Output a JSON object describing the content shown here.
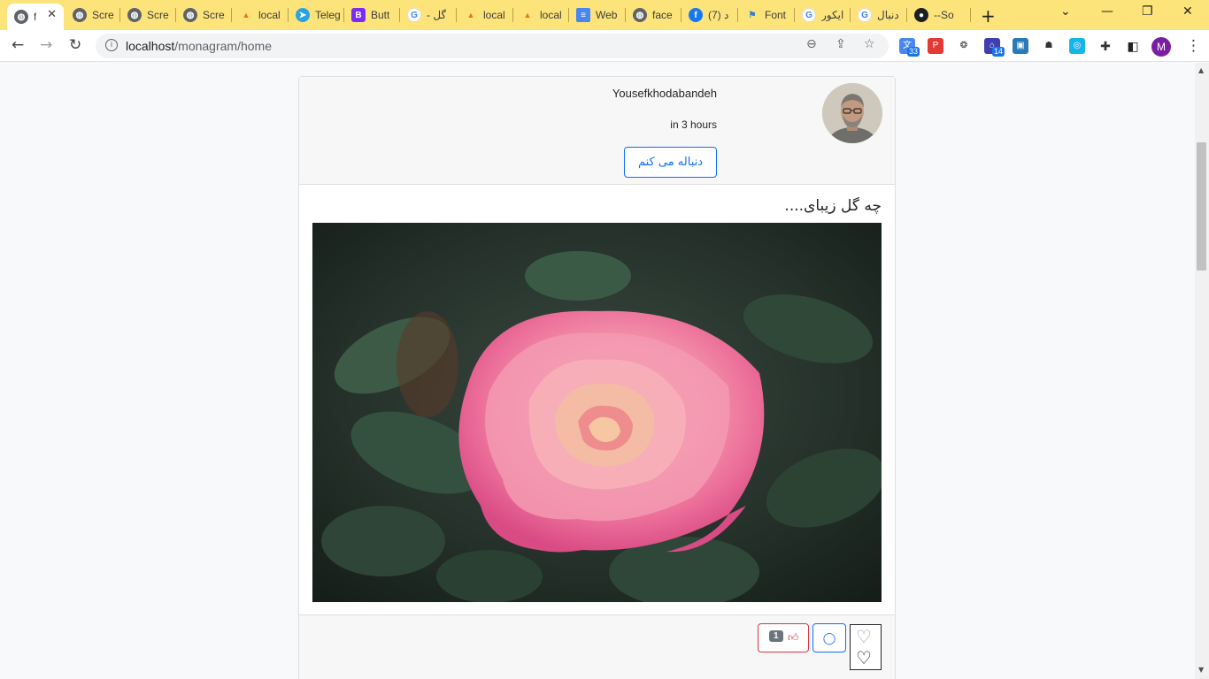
{
  "browser": {
    "tabs": [
      {
        "title": "f",
        "icon": "globe-icon",
        "active": true
      },
      {
        "title": "Scre",
        "icon": "globe-icon"
      },
      {
        "title": "Scre",
        "icon": "globe-icon"
      },
      {
        "title": "Scre",
        "icon": "globe-icon"
      },
      {
        "title": "local",
        "icon": "phpmyadmin-icon"
      },
      {
        "title": "Teleg",
        "icon": "telegram-icon"
      },
      {
        "title": "Butt",
        "icon": "bootstrap-icon"
      },
      {
        "title": "گل -",
        "icon": "google-icon"
      },
      {
        "title": "local",
        "icon": "phpmyadmin-icon"
      },
      {
        "title": "local",
        "icon": "phpmyadmin-icon"
      },
      {
        "title": "Web",
        "icon": "docs-icon"
      },
      {
        "title": "face",
        "icon": "globe-icon"
      },
      {
        "title": "(7) د",
        "icon": "facebook-icon"
      },
      {
        "title": "Font",
        "icon": "flag-icon"
      },
      {
        "title": "ایکور",
        "icon": "google-icon"
      },
      {
        "title": "دنبال",
        "icon": "google-icon"
      },
      {
        "title": "--So",
        "icon": "github-icon"
      }
    ],
    "url_host": "localhost",
    "url_path": "/monagram/home",
    "extension_badges": {
      "translate": "33",
      "ext14": "14"
    },
    "profile_initial": "M"
  },
  "post": {
    "username": "Yousefkhodabandeh",
    "time_ago": "in 3 hours",
    "follow_label": "دنباله می کنم",
    "caption": "چه گل زیبای....",
    "like_count": "1"
  },
  "colors": {
    "tab_strip": "#fde47a",
    "primary": "#0d6efd",
    "danger": "#dc3545",
    "secondary": "#6c757d"
  }
}
